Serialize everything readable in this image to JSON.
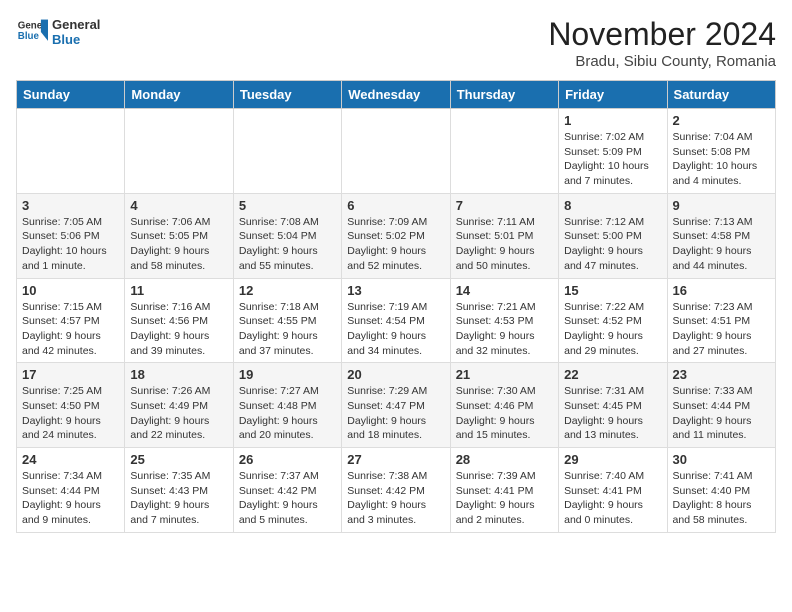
{
  "header": {
    "logo_general": "General",
    "logo_blue": "Blue",
    "month_title": "November 2024",
    "location": "Bradu, Sibiu County, Romania"
  },
  "days_of_week": [
    "Sunday",
    "Monday",
    "Tuesday",
    "Wednesday",
    "Thursday",
    "Friday",
    "Saturday"
  ],
  "weeks": [
    [
      {
        "day": "",
        "info": ""
      },
      {
        "day": "",
        "info": ""
      },
      {
        "day": "",
        "info": ""
      },
      {
        "day": "",
        "info": ""
      },
      {
        "day": "",
        "info": ""
      },
      {
        "day": "1",
        "info": "Sunrise: 7:02 AM\nSunset: 5:09 PM\nDaylight: 10 hours and 7 minutes."
      },
      {
        "day": "2",
        "info": "Sunrise: 7:04 AM\nSunset: 5:08 PM\nDaylight: 10 hours and 4 minutes."
      }
    ],
    [
      {
        "day": "3",
        "info": "Sunrise: 7:05 AM\nSunset: 5:06 PM\nDaylight: 10 hours and 1 minute."
      },
      {
        "day": "4",
        "info": "Sunrise: 7:06 AM\nSunset: 5:05 PM\nDaylight: 9 hours and 58 minutes."
      },
      {
        "day": "5",
        "info": "Sunrise: 7:08 AM\nSunset: 5:04 PM\nDaylight: 9 hours and 55 minutes."
      },
      {
        "day": "6",
        "info": "Sunrise: 7:09 AM\nSunset: 5:02 PM\nDaylight: 9 hours and 52 minutes."
      },
      {
        "day": "7",
        "info": "Sunrise: 7:11 AM\nSunset: 5:01 PM\nDaylight: 9 hours and 50 minutes."
      },
      {
        "day": "8",
        "info": "Sunrise: 7:12 AM\nSunset: 5:00 PM\nDaylight: 9 hours and 47 minutes."
      },
      {
        "day": "9",
        "info": "Sunrise: 7:13 AM\nSunset: 4:58 PM\nDaylight: 9 hours and 44 minutes."
      }
    ],
    [
      {
        "day": "10",
        "info": "Sunrise: 7:15 AM\nSunset: 4:57 PM\nDaylight: 9 hours and 42 minutes."
      },
      {
        "day": "11",
        "info": "Sunrise: 7:16 AM\nSunset: 4:56 PM\nDaylight: 9 hours and 39 minutes."
      },
      {
        "day": "12",
        "info": "Sunrise: 7:18 AM\nSunset: 4:55 PM\nDaylight: 9 hours and 37 minutes."
      },
      {
        "day": "13",
        "info": "Sunrise: 7:19 AM\nSunset: 4:54 PM\nDaylight: 9 hours and 34 minutes."
      },
      {
        "day": "14",
        "info": "Sunrise: 7:21 AM\nSunset: 4:53 PM\nDaylight: 9 hours and 32 minutes."
      },
      {
        "day": "15",
        "info": "Sunrise: 7:22 AM\nSunset: 4:52 PM\nDaylight: 9 hours and 29 minutes."
      },
      {
        "day": "16",
        "info": "Sunrise: 7:23 AM\nSunset: 4:51 PM\nDaylight: 9 hours and 27 minutes."
      }
    ],
    [
      {
        "day": "17",
        "info": "Sunrise: 7:25 AM\nSunset: 4:50 PM\nDaylight: 9 hours and 24 minutes."
      },
      {
        "day": "18",
        "info": "Sunrise: 7:26 AM\nSunset: 4:49 PM\nDaylight: 9 hours and 22 minutes."
      },
      {
        "day": "19",
        "info": "Sunrise: 7:27 AM\nSunset: 4:48 PM\nDaylight: 9 hours and 20 minutes."
      },
      {
        "day": "20",
        "info": "Sunrise: 7:29 AM\nSunset: 4:47 PM\nDaylight: 9 hours and 18 minutes."
      },
      {
        "day": "21",
        "info": "Sunrise: 7:30 AM\nSunset: 4:46 PM\nDaylight: 9 hours and 15 minutes."
      },
      {
        "day": "22",
        "info": "Sunrise: 7:31 AM\nSunset: 4:45 PM\nDaylight: 9 hours and 13 minutes."
      },
      {
        "day": "23",
        "info": "Sunrise: 7:33 AM\nSunset: 4:44 PM\nDaylight: 9 hours and 11 minutes."
      }
    ],
    [
      {
        "day": "24",
        "info": "Sunrise: 7:34 AM\nSunset: 4:44 PM\nDaylight: 9 hours and 9 minutes."
      },
      {
        "day": "25",
        "info": "Sunrise: 7:35 AM\nSunset: 4:43 PM\nDaylight: 9 hours and 7 minutes."
      },
      {
        "day": "26",
        "info": "Sunrise: 7:37 AM\nSunset: 4:42 PM\nDaylight: 9 hours and 5 minutes."
      },
      {
        "day": "27",
        "info": "Sunrise: 7:38 AM\nSunset: 4:42 PM\nDaylight: 9 hours and 3 minutes."
      },
      {
        "day": "28",
        "info": "Sunrise: 7:39 AM\nSunset: 4:41 PM\nDaylight: 9 hours and 2 minutes."
      },
      {
        "day": "29",
        "info": "Sunrise: 7:40 AM\nSunset: 4:41 PM\nDaylight: 9 hours and 0 minutes."
      },
      {
        "day": "30",
        "info": "Sunrise: 7:41 AM\nSunset: 4:40 PM\nDaylight: 8 hours and 58 minutes."
      }
    ]
  ]
}
